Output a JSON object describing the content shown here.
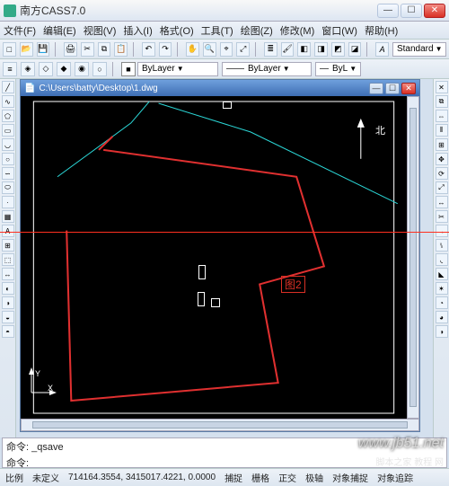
{
  "app": {
    "title": "南方CASS7.0"
  },
  "menu": {
    "file": "文件(F)",
    "edit": "编辑(E)",
    "view": "视图(V)",
    "insert": "插入(I)",
    "format": "格式(O)",
    "tools": "工具(T)",
    "draw": "绘图(Z)",
    "modify": "修改(M)",
    "window": "窗口(W)",
    "help": "帮助(H)"
  },
  "toolbar": {
    "style": "Standard"
  },
  "layer": {
    "current": "ByLayer",
    "linetype": "ByLayer",
    "lineweight": "ByL"
  },
  "doc": {
    "path": "C:\\Users\\batty\\Desktop\\1.dwg"
  },
  "annotations": {
    "fig2": "图2",
    "northchar": "北"
  },
  "command": {
    "history": "命令: _qsave",
    "prompt": "命令:"
  },
  "status": {
    "label_scale": "比例",
    "scale_val": "未定义",
    "coords": "714164.3554, 3415017.4221, 0.0000",
    "snap": "捕捉",
    "grid": "栅格",
    "ortho": "正交",
    "polar": "极轴",
    "osnap": "对象捕捉",
    "otrack": "对象追踪"
  },
  "watermark": {
    "main": "www.jb51.net",
    "sub": "脚本之家 教程 网"
  }
}
